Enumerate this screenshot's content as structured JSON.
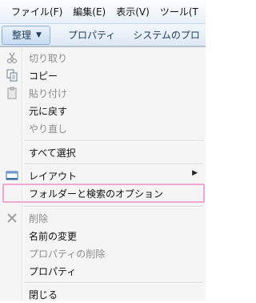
{
  "menubar": {
    "file": "ファイル(F)",
    "edit": "編集(E)",
    "view": "表示(V)",
    "tools": "ツール(T"
  },
  "toolbar": {
    "organize": "整理",
    "properties": "プロパティ",
    "system": "システムのプロ"
  },
  "menu": {
    "cut": "切り取り",
    "copy": "コピー",
    "paste": "貼り付け",
    "undo": "元に戻す",
    "redo": "やり直し",
    "select_all": "すべて選択",
    "layout": "レイアウト",
    "folder_options": "フォルダーと検索のオプション",
    "delete": "削除",
    "rename": "名前の変更",
    "remove_properties": "プロパティの削除",
    "properties": "プロパティ",
    "close": "閉じる"
  },
  "colors": {
    "highlight_border": "#f0a8d2",
    "menu_bg": "#f5f5f5",
    "toolbar_text": "#1e3b5c"
  },
  "icons": {
    "cut": "scissors-icon",
    "copy": "copy-icon",
    "paste": "clipboard-icon",
    "layout": "layout-icon",
    "delete": "delete-x-icon"
  }
}
